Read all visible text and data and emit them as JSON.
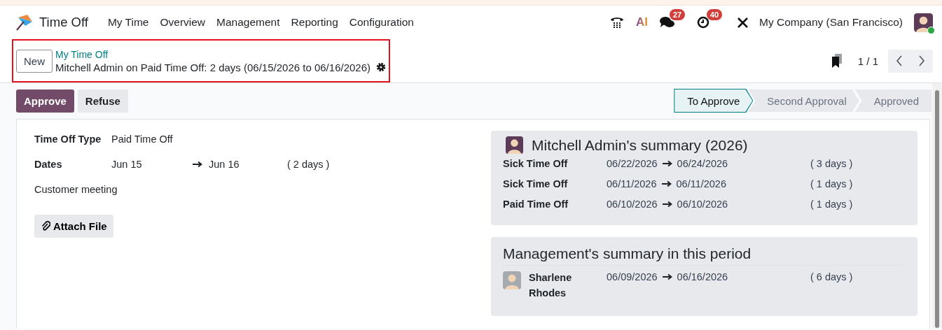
{
  "navbar": {
    "app_name": "Time Off",
    "menu": [
      "My Time",
      "Overview",
      "Management",
      "Reporting",
      "Configuration"
    ],
    "ai_label": "AI",
    "messages_badge": "27",
    "activities_badge": "40",
    "company": "My Company (San Francisco)",
    "user_online": true
  },
  "control_panel": {
    "new_button": "New",
    "breadcrumb": "My Time Off",
    "record_title": "Mitchell Admin on Paid Time Off: 2 days (06/15/2026 to 06/16/2026)",
    "pager": "1 / 1"
  },
  "actions": [
    {
      "label": "Approve",
      "kind": "primary"
    },
    {
      "label": "Refuse",
      "kind": "secondary"
    }
  ],
  "status_steps": [
    {
      "label": "To Approve",
      "selected": true
    },
    {
      "label": "Second Approval",
      "selected": false
    },
    {
      "label": "Approved",
      "selected": false
    }
  ],
  "form": {
    "type_label": "Time Off Type",
    "type_value": "Paid Time Off",
    "dates_label": "Dates",
    "date_from": "Jun 15",
    "date_to": "Jun 16",
    "duration": "( 2 days )",
    "description": "Customer meeting",
    "attach_button": "Attach File"
  },
  "employee_summary": {
    "title": "Mitchell Admin's summary (2026)",
    "rows": [
      {
        "type": "Sick Time Off",
        "from": "06/22/2026",
        "to": "06/24/2026",
        "duration": "( 3 days )"
      },
      {
        "type": "Sick Time Off",
        "from": "06/11/2026",
        "to": "06/11/2026",
        "duration": "( 1 days )"
      },
      {
        "type": "Paid Time Off",
        "from": "06/10/2026",
        "to": "06/10/2026",
        "duration": "( 1 days )"
      }
    ]
  },
  "management_summary": {
    "title": "Management's summary in this period",
    "rows": [
      {
        "name": "Sharlene Rhodes",
        "from": "06/09/2026",
        "to": "06/16/2026",
        "duration": "( 6 days )"
      }
    ]
  }
}
